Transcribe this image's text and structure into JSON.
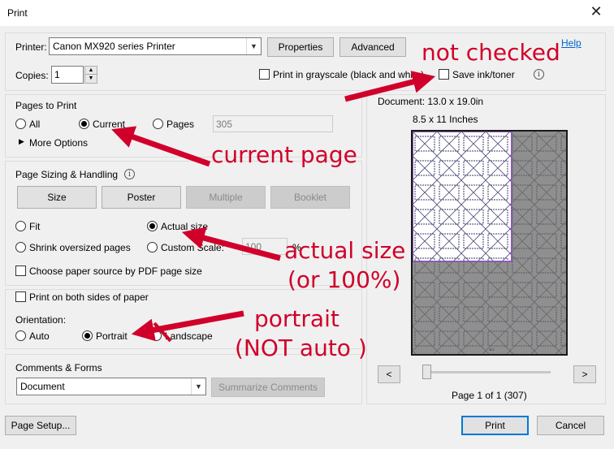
{
  "window": {
    "title": "Print",
    "close_glyph": "✕"
  },
  "printer": {
    "label": "Printer:",
    "value": "Canon MX920 series Printer",
    "properties": "Properties",
    "advanced": "Advanced",
    "help": "Help"
  },
  "copies": {
    "label": "Copies:",
    "value": "1"
  },
  "options": {
    "grayscale": "Print in grayscale (black and white)",
    "save_ink": "Save ink/toner"
  },
  "pages_to_print": {
    "title": "Pages to Print",
    "all": "All",
    "current": "Current",
    "pages": "Pages",
    "pages_value": "305",
    "more_options": "More Options"
  },
  "sizing": {
    "title": "Page Sizing & Handling",
    "tabs": [
      "Size",
      "Poster",
      "Multiple",
      "Booklet"
    ],
    "fit": "Fit",
    "actual_size": "Actual size",
    "shrink": "Shrink oversized pages",
    "custom_scale": "Custom Scale:",
    "scale_value": "100",
    "percent": "%",
    "paper_source": "Choose paper source by PDF page size"
  },
  "duplex": {
    "label": "Print on both sides of paper"
  },
  "orientation": {
    "label": "Orientation:",
    "auto": "Auto",
    "portrait": "Portrait",
    "landscape": "Landscape"
  },
  "comments": {
    "title": "Comments & Forms",
    "value": "Document",
    "summarize": "Summarize Comments"
  },
  "preview": {
    "document": "Document: 13.0 x 19.0in",
    "paper": "8.5 x 11 Inches",
    "prev": "<",
    "next": ">",
    "page_status": "Page 1 of 1 (307)",
    "page_number_text": "307",
    "slider_fraction": 0
  },
  "footer": {
    "page_setup": "Page Setup...",
    "print": "Print",
    "cancel": "Cancel"
  },
  "annotations": {
    "not_checked": "not checked",
    "current_page": "current page",
    "actual_size_1": "actual size",
    "actual_size_2": "(or 100%)",
    "portrait_1": "portrait",
    "portrait_2": "(NOT auto )",
    "color": "#d0002a"
  }
}
